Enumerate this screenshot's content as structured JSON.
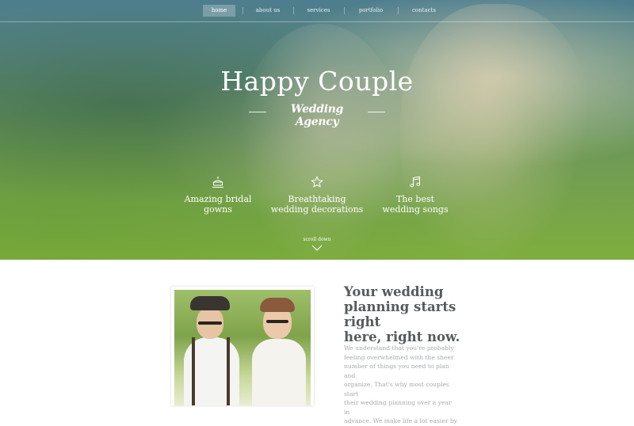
{
  "nav": {
    "items": [
      {
        "label": "home",
        "active": true
      },
      {
        "label": "about us"
      },
      {
        "label": "services"
      },
      {
        "label": "portfolio"
      },
      {
        "label": "contacts"
      }
    ]
  },
  "hero": {
    "title": "Happy Couple",
    "subtitle": "Wedding Agency",
    "features": [
      {
        "icon": "cake-icon",
        "label_line1": "Amazing bridal",
        "label_line2": "gowns"
      },
      {
        "icon": "star-icon",
        "label_line1": "Breathtaking",
        "label_line2": "wedding decorations"
      },
      {
        "icon": "music-note-icon",
        "label_line1": "The best",
        "label_line2": "wedding songs"
      }
    ],
    "scroll_label": "scroll down"
  },
  "intro": {
    "headline_line1": "Your wedding",
    "headline_line2": "planning starts right",
    "headline_line3": "here, right now.",
    "body_lines": [
      "We understand that you're probably",
      "feeling overwhelmed with the sheer",
      "number of things you need to plan and",
      "organize. That's why most couples start",
      "their wedding planning over a year in",
      "advance. We make life a lot easier by"
    ]
  },
  "colors": {
    "hero_top": "#4d7d8e",
    "hero_bottom": "#7fae3e",
    "headline": "#555a5d",
    "body_text": "#a7abad"
  }
}
